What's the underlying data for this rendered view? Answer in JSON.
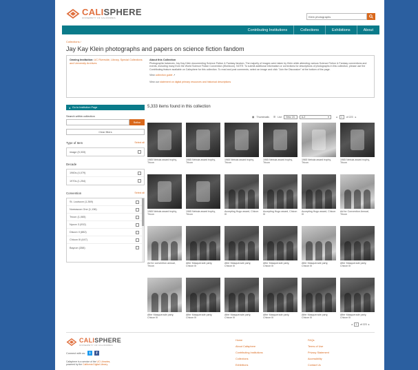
{
  "header": {
    "logo_cali": "CALI",
    "logo_sphere": "SPHERE",
    "logo_sub": "UNIVERSITY OF CALIFORNIA",
    "search_value": "Klein photographs",
    "brand_color": "#e0703f"
  },
  "nav": {
    "items": [
      "Contributing Institutions",
      "Collections",
      "Exhibitions",
      "About"
    ],
    "bar_color": "#0a7b8a"
  },
  "breadcrumb": "Collections /",
  "title": "Jay Kay Klein photographs and papers on science fiction fandom",
  "info": {
    "owning_label": "Owning Institution:",
    "owning_value": "UC Riverside, Library, Special Collections and University Archives",
    "about_heading": "About this Collection",
    "about_text": "Photographic balances, Jay Kay Klein documenting Science Fiction & Fantasy fandom. The majority of images were taken by Klein while attending various Science Fiction & Fantasy conventions and events, including many from the World Science Fiction Convention (Worldcon). NOTE: To submit additional information or corrections for descriptions of photographs in this collection, please use the Contributing feature available on Calisphere for this collection. To read and post comments, select an image and click \"Join the Discussion\" at the bottom of the page.",
    "guide_prefix": "View",
    "guide_link": "collection guide",
    "statement_prefix": "View our",
    "statement_link": "statement on digital primary resources and historical descriptions"
  },
  "sidebar": {
    "go_button": "Go to Institution Page",
    "search_within_label": "Search within collection",
    "refine_label": "Refine",
    "clear_label": "Clear filters",
    "select_all": "Select all",
    "type_heading": "Type of Item",
    "type_options": [
      "image (5,333)"
    ],
    "decade_heading": "Decade",
    "decade_options": [
      "1960s (4,079)",
      "1970s (1,254)"
    ],
    "convention_heading": "Convention",
    "convention_options": [
      "St. Louiscon (1,369)",
      "Noreascon One (1,136)",
      "Tricon (1,065)",
      "Nycon 3 (932)",
      "Discon II (882)",
      "Chicon III (447)",
      "Baycon (358)"
    ]
  },
  "results": {
    "count_text": "5,333 items found in this collection",
    "thumbnails_label": "Thumbnails",
    "list_label": "List",
    "view_select": "View: 24",
    "sort_select": "A-Z",
    "page_current": "1",
    "page_total": "of 223"
  },
  "items": [
    {
      "caption": "1965 Nebula award trophy, Tricon",
      "tone": "dark"
    },
    {
      "caption": "1965 Nebula award trophy, Tricon",
      "tone": "dark"
    },
    {
      "caption": "1965 Nebula award trophy, Tricon",
      "tone": "dark"
    },
    {
      "caption": "1965 Nebula award trophy, Tricon",
      "tone": "dark"
    },
    {
      "caption": "1965 Nebula award trophy, Tricon",
      "tone": "light"
    },
    {
      "caption": "1965 Nebula award trophy, Tricon",
      "tone": "dark"
    },
    {
      "caption": "1965 Nebula award trophy, Tricon",
      "tone": "dark"
    },
    {
      "caption": "1965 Nebula award trophy, Tricon",
      "tone": "dark"
    },
    {
      "caption": "Accepting Hugo award, Chicon III",
      "tone": "mid"
    },
    {
      "caption": "Accepting Hugo award, Chicon III",
      "tone": "mid"
    },
    {
      "caption": "Accepting Hugo award, Chicon III",
      "tone": "mid"
    },
    {
      "caption": "Ad for Convention Annual, Tricon",
      "tone": "light"
    },
    {
      "caption": "Ad for convention annual, Tricon",
      "tone": "light"
    },
    {
      "caption": "After Masquerade party, Chicon III",
      "tone": "mid"
    },
    {
      "caption": "After Masquerade party, Chicon III",
      "tone": "mid"
    },
    {
      "caption": "After Masquerade party, Chicon III",
      "tone": "mid"
    },
    {
      "caption": "After Masquerade party, Chicon III",
      "tone": "light"
    },
    {
      "caption": "After Masquerade party, Chicon III",
      "tone": "mid"
    },
    {
      "caption": "After Masquerade party, Chicon III",
      "tone": "light"
    },
    {
      "caption": "After Masquerade party, Chicon III",
      "tone": "mid"
    },
    {
      "caption": "After Masquerade party, Chicon III",
      "tone": "mid"
    },
    {
      "caption": "After Masquerade party, Chicon III",
      "tone": "mid"
    },
    {
      "caption": "After Masquerade party, Chicon III",
      "tone": "mid"
    },
    {
      "caption": "After Masquerade party, Chicon III",
      "tone": "mid"
    }
  ],
  "footer": {
    "logo_cali": "CALI",
    "logo_sphere": "SPHERE",
    "logo_sub": "UNIVERSITY OF CALIFORNIA",
    "connect_label": "Connect with us:",
    "note_prefix": "Calisphere is a service of the",
    "note_link1": "UC Libraries,",
    "note_mid": "powered by the",
    "note_link2": "California Digital Library.",
    "col1": [
      "Home",
      "About Calisphere",
      "Contributing Institutions",
      "Collections",
      "Exhibitions"
    ],
    "col2": [
      "FAQs",
      "Terms of Use",
      "Privacy Statement",
      "Accessibility",
      "Contact Us"
    ]
  }
}
